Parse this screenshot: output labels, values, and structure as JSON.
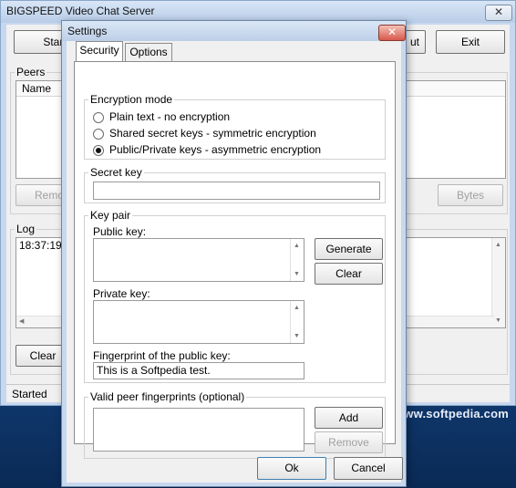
{
  "main_window": {
    "title": "BIGSPEED Video Chat Server",
    "start_label": "Start",
    "out_label": "ut",
    "exit_label": "Exit",
    "peers_label": "Peers",
    "name_column": "Name",
    "remove_label": "Remov",
    "bytes_label": "Bytes",
    "log_label": "Log",
    "log_entry": "18:37:19: s",
    "clear_label": "Clear",
    "status": "Started"
  },
  "watermark": "www.softpedia.com",
  "dialog": {
    "title": "Settings",
    "tabs": [
      "Security",
      "Options"
    ],
    "encryption": {
      "label": "Encryption mode",
      "options": [
        {
          "label": "Plain text - no encryption",
          "selected": false
        },
        {
          "label": "Shared secret keys - symmetric encryption",
          "selected": false
        },
        {
          "label": "Public/Private keys - asymmetric encryption",
          "selected": true
        }
      ]
    },
    "secret_key": {
      "label": "Secret key",
      "value": ""
    },
    "key_pair": {
      "label": "Key pair",
      "public_label": "Public key:",
      "private_label": "Private key:",
      "generate_label": "Generate",
      "clear_label": "Clear",
      "fingerprint_label": "Fingerprint of the public key:",
      "fingerprint_value": "This is a Softpedia test."
    },
    "valid_peers": {
      "label": "Valid peer fingerprints (optional)",
      "add_label": "Add",
      "remove_label": "Remove"
    },
    "ok_label": "Ok",
    "cancel_label": "Cancel"
  }
}
